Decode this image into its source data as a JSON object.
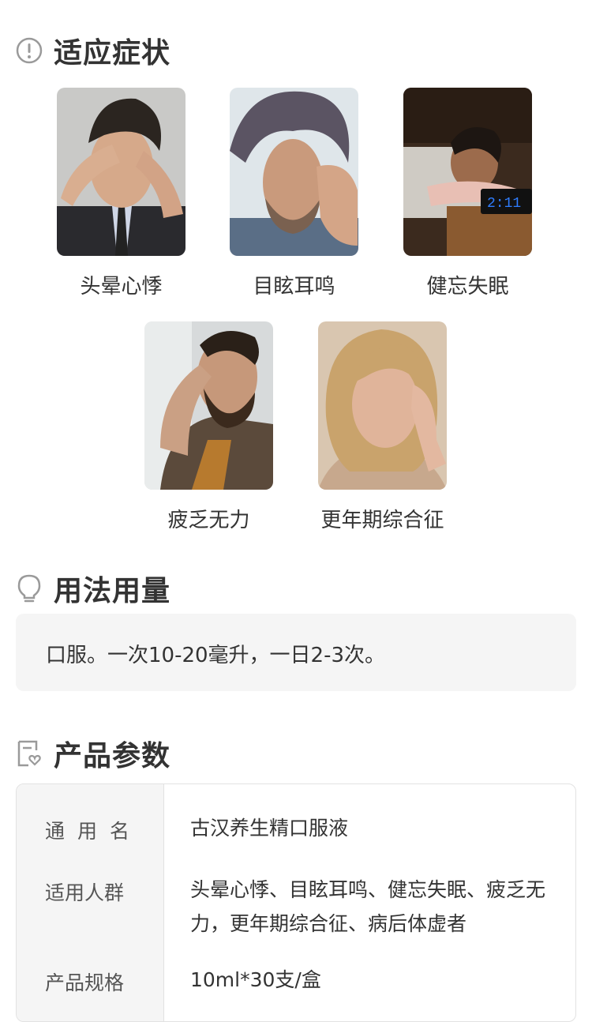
{
  "sections": {
    "symptoms": {
      "title": "适应症状",
      "icon": "exclamation-circle-icon"
    },
    "usage": {
      "title": "用法用量",
      "icon": "lightbulb-icon",
      "text": "口服。一次10-20毫升，一日2-3次。"
    },
    "params": {
      "title": "产品参数",
      "icon": "document-heart-icon"
    }
  },
  "symptoms": [
    {
      "label": "头晕心悸",
      "image": "man-headache-photo"
    },
    {
      "label": "目眩耳鸣",
      "image": "man-ear-pain-photo"
    },
    {
      "label": "健忘失眠",
      "image": "man-insomnia-clock-photo"
    },
    {
      "label": "疲乏无力",
      "image": "man-fatigue-photo"
    },
    {
      "label": "更年期综合征",
      "image": "woman-menopause-photo"
    }
  ],
  "params_table": [
    {
      "key": "通用名",
      "value": "古汉养生精口服液"
    },
    {
      "key": "适用人群",
      "value": "头晕心悸、目眩耳鸣、健忘失眠、疲乏无力，更年期综合征、病后体虚者"
    },
    {
      "key": "产品规格",
      "value": "10ml*30支/盒"
    }
  ],
  "colors": {
    "icon_gray": "#9a9a9a",
    "text": "#333333",
    "box_bg": "#f5f5f5",
    "border": "#e2e2e2"
  }
}
